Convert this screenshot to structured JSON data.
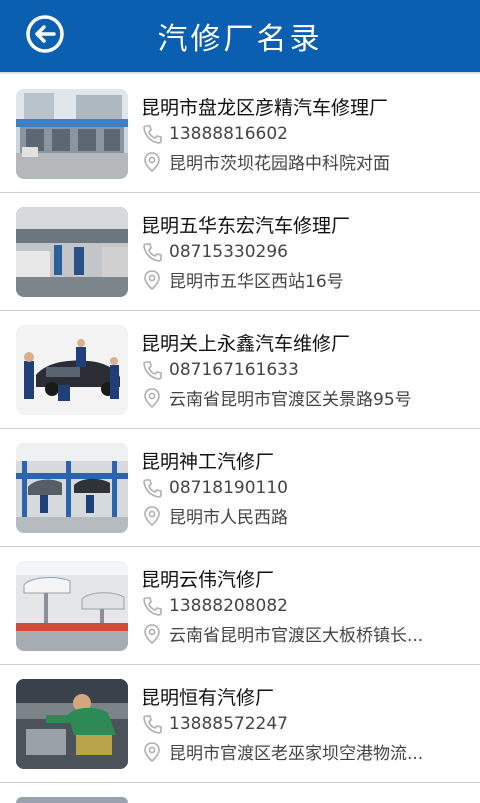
{
  "header": {
    "title": "汽修厂名录"
  },
  "items": [
    {
      "name": "昆明市盘龙区彦精汽车修理厂",
      "phone": "13888816602",
      "address": "昆明市茨坝花园路中科院对面"
    },
    {
      "name": "昆明五华东宏汽车修理厂",
      "phone": "08715330296",
      "address": "昆明市五华区西站16号"
    },
    {
      "name": "昆明关上永鑫汽车维修厂",
      "phone": "087167161633",
      "address": "云南省昆明市官渡区关景路95号"
    },
    {
      "name": "昆明神工汽修厂",
      "phone": "08718190110",
      "address": "昆明市人民西路"
    },
    {
      "name": "昆明云伟汽修厂",
      "phone": "13888208082",
      "address": "云南省昆明市官渡区大板桥镇长..."
    },
    {
      "name": "昆明恒有汽修厂",
      "phone": "13888572247",
      "address": "昆明市官渡区老巫家坝空港物流..."
    }
  ],
  "colors": {
    "header": "#0b5fb0",
    "icon": "#b0b0b0"
  }
}
